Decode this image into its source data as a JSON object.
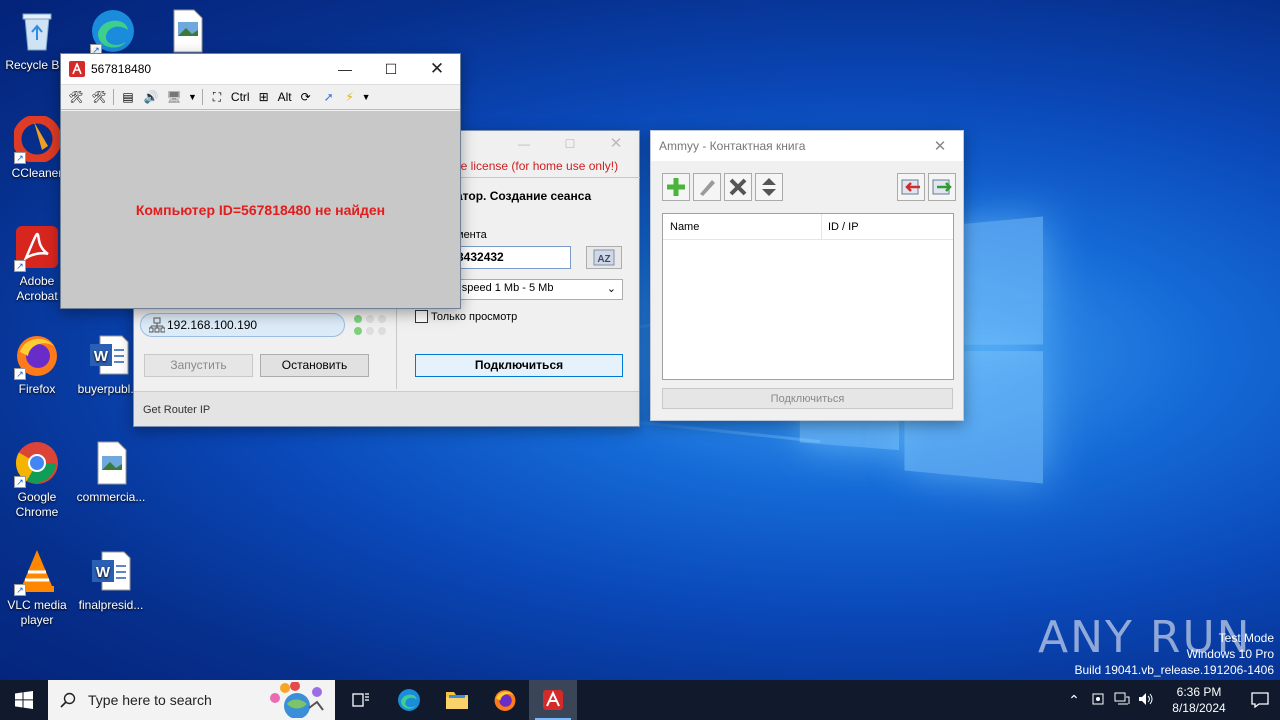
{
  "desktop": {
    "icons": [
      {
        "label": "Recycle Bin",
        "icon": "recycle-bin-icon"
      },
      {
        "label": "",
        "icon": "edge-icon"
      },
      {
        "label": "",
        "icon": "image-file-icon"
      },
      {
        "label": "CCleaner",
        "icon": "ccleaner-icon"
      },
      {
        "label": "Adobe Acrobat",
        "icon": "acrobat-icon"
      },
      {
        "label": "Firefox",
        "icon": "firefox-icon"
      },
      {
        "label": "buyerpubl...",
        "icon": "word-doc-icon"
      },
      {
        "label": "Google Chrome",
        "icon": "chrome-icon"
      },
      {
        "label": "commercia...",
        "icon": "image-file-icon"
      },
      {
        "label": "VLC media player",
        "icon": "vlc-icon"
      },
      {
        "label": "finalpresid...",
        "icon": "word-doc-icon"
      }
    ],
    "watermark": {
      "brand": "ANY RUN",
      "line1": "Test Mode",
      "line2": "Windows 10 Pro",
      "line3": "Build 19041.vb_release.191206-1406"
    }
  },
  "remote_window": {
    "title": "567818480",
    "toolbar": {
      "ctrl": "Ctrl",
      "alt": "Alt"
    },
    "message": "Компьютер ID=567818480 не найден"
  },
  "ammyy_main": {
    "license_text": "ee license (for home use only!)",
    "operator_heading": "атор. Создание сеанса",
    "client_label": "мента",
    "client_id_value": "3432432",
    "speed_value": "- speed  1 Mb - 5 Mb",
    "view_only_label": "Только просмотр",
    "connect_label": "Подключиться",
    "ip_value": "192.168.100.190",
    "start_label": "Запустить",
    "stop_label": "Остановить",
    "status_text": "Get Router IP"
  },
  "contacts_window": {
    "title": "Ammyy - Контактная книга",
    "col_name": "Name",
    "col_id": "ID / IP",
    "connect_label": "Подключиться"
  },
  "taskbar": {
    "search_placeholder": "Type here to search",
    "time": "6:36 PM",
    "date": "8/18/2024"
  },
  "colors": {
    "error_red": "#e31c1c",
    "license_red": "#d02020",
    "taskbar_bg": "#101a2c"
  }
}
